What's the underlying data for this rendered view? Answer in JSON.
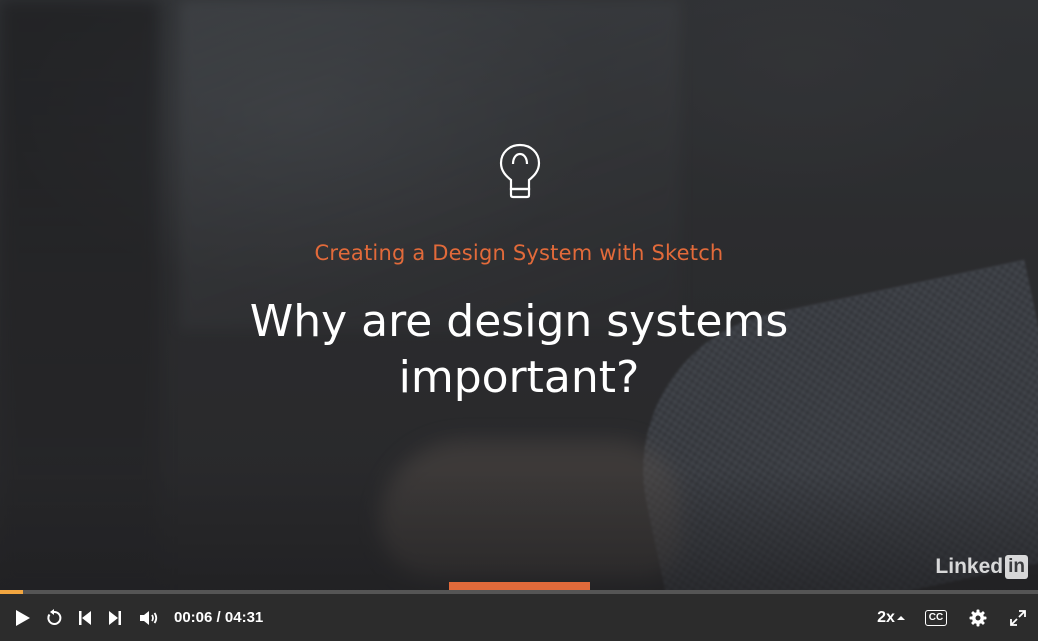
{
  "video": {
    "course_title": "Creating a Design System with Sketch",
    "heading": "Why are design systems important?",
    "brand_logo_text": "Linked",
    "brand_logo_box": "in",
    "icon": "lightbulb-icon"
  },
  "player": {
    "current_time": "00:06",
    "separator": " / ",
    "duration": "04:31",
    "progress_fraction": 0.022,
    "speed_label": "2x",
    "captions_label": "CC",
    "accent_color": "#e26a3a",
    "progress_color": "#f2a640",
    "controls": [
      "play-icon",
      "replay-icon",
      "skip-previous-icon",
      "skip-next-icon",
      "volume-icon",
      "speed-up-arrow-icon",
      "settings-gear-icon",
      "fullscreen-icon"
    ]
  }
}
